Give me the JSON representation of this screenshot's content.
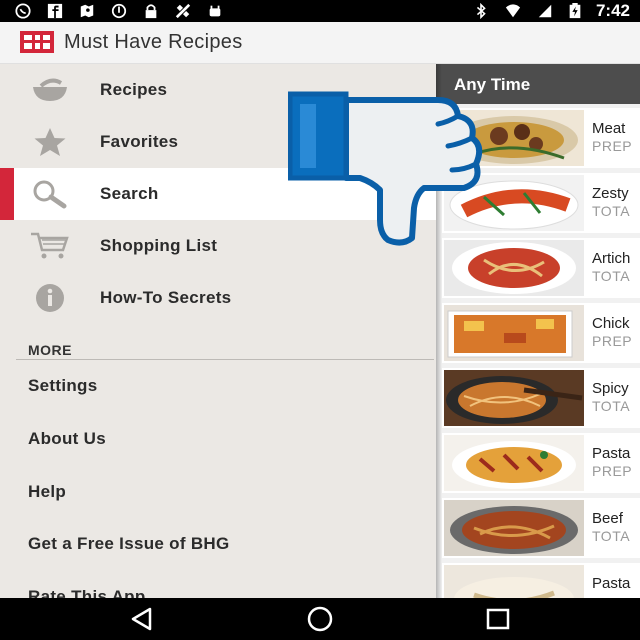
{
  "status_bar": {
    "time": "7:42",
    "icons_left": [
      "whatsapp-icon",
      "facebook-icon",
      "maps-icon",
      "sync-icon",
      "lock-icon",
      "satellite-icon",
      "android-icon"
    ],
    "icons_right": [
      "bluetooth-icon",
      "wifi-icon",
      "signal-icon",
      "battery-charging-icon"
    ]
  },
  "app_bar": {
    "title": "Must Have Recipes",
    "logo": "bhg-logo-icon",
    "accent_color": "#d3263a"
  },
  "drawer": {
    "nav_items": [
      {
        "label": "Recipes",
        "icon": "bowl-icon",
        "active": false
      },
      {
        "label": "Favorites",
        "icon": "star-icon",
        "active": false
      },
      {
        "label": "Search",
        "icon": "search-icon",
        "active": true
      },
      {
        "label": "Shopping List",
        "icon": "cart-icon",
        "active": false
      },
      {
        "label": "How-To Secrets",
        "icon": "info-icon",
        "active": false
      }
    ],
    "more_header": "MORE",
    "more_items": [
      {
        "label": "Settings"
      },
      {
        "label": "About Us"
      },
      {
        "label": "Help"
      },
      {
        "label": "Get a Free Issue of BHG"
      },
      {
        "label": "Rate This App"
      }
    ]
  },
  "content": {
    "section_title": "Any Time",
    "recipes": [
      {
        "name": "Meat",
        "meta": "PREP"
      },
      {
        "name": "Zesty",
        "meta": "TOTA"
      },
      {
        "name": "Artich",
        "meta": "TOTA"
      },
      {
        "name": "Chick",
        "meta": "PREP"
      },
      {
        "name": "Spicy",
        "meta": "TOTA"
      },
      {
        "name": "Pasta",
        "meta": "PREP"
      },
      {
        "name": "Beef",
        "meta": "TOTA"
      },
      {
        "name": "Pasta",
        "meta": ""
      }
    ]
  },
  "overlay": {
    "icon": "thumbs-down-icon",
    "fill_color": "#0a6ebd"
  },
  "nav_bar": {
    "buttons": [
      "back-icon",
      "home-icon",
      "recents-icon"
    ]
  }
}
